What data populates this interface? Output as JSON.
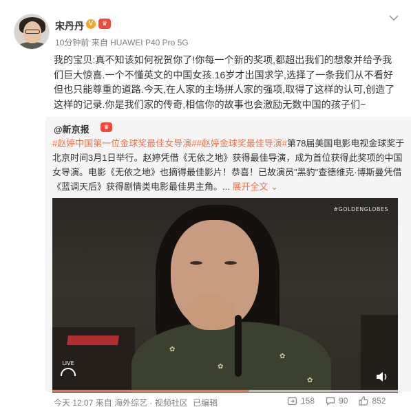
{
  "header": {
    "username": "宋丹丹",
    "verified_badge": "V",
    "member_badge": "会员",
    "time": "10分钟前",
    "source_prefix": "来自",
    "device": "HUAWEI P40 Pro 5G",
    "menu_icon": "chevron-down-icon"
  },
  "main_text": "我的宝贝:真不知该如何祝贺你了!你每一个新的奖项,都超出我们的想象并给予我们巨大惊喜.一个不懂英文的中国女孩.16岁才出国求学,选择了一条我们从不看好但也只能尊重的道路.今天,在人家的主场拼人家的强项,取得了这样的认可,创造了这样的记录.你是我们家的传奇,相信你的故事也会激励无数中国的孩子们~",
  "repost": {
    "user": "@新京报",
    "member_badge": "会员",
    "tag1": "#赵婷中国第一位金球奖最佳女导演#",
    "tag2": "#赵婷金球奖最佳导演#",
    "body": "第78届美国电影电视金球奖于北京时间3月1日举行。赵婷凭借《无依之地》获得最佳导演，成为首位获得此奖项的中国女导演。电影《无依之地》也摘得最佳影片！恭喜！已故演员\"黑豹\"查德维克·博斯曼凭借《蓝调天后》获得剧情类电影最佳男主角。",
    "expand_arrow": "...",
    "expand_label": "展开全文",
    "expand_icon": "chevron-down-icon",
    "video": {
      "watermark": "#GOLDENGLOBES",
      "live_label": "LIVE",
      "network_icon": "peacock-icon",
      "volume_icon": "speaker-icon",
      "progress": 0.57,
      "progress_color": "#eb7350"
    }
  },
  "footer": {
    "time": "今天 12:07",
    "source_prefix": "来自",
    "source": "海外综艺 · 视频社区",
    "edited": "已编辑",
    "reposts": "158",
    "comments": "90",
    "likes": "852"
  },
  "colors": {
    "accent": "#eb7350",
    "muted": "#808080",
    "repost_bg": "#f5f5f5"
  }
}
